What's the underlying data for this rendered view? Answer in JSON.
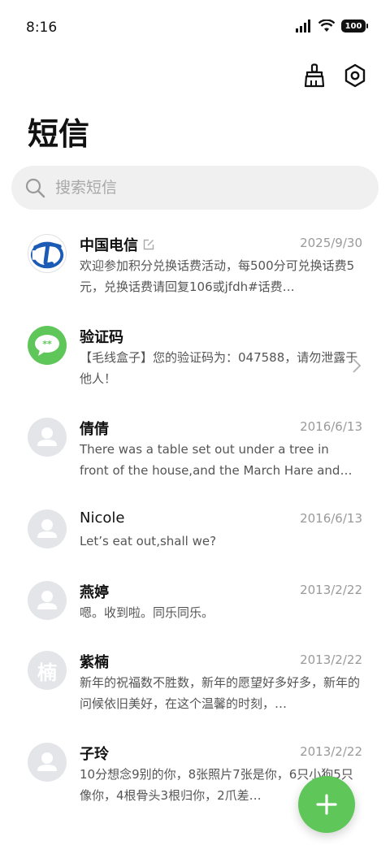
{
  "status": {
    "time": "8:16",
    "battery": "100"
  },
  "header": {
    "title": "短信"
  },
  "search": {
    "placeholder": "搜索短信"
  },
  "colors": {
    "accent": "#5fc659",
    "avatar_gray": "#e4e5e8",
    "carrier_blue": "#1c5bb5"
  },
  "messages": [
    {
      "name": "中国电信",
      "date": "2025/9/30",
      "preview": "欢迎参加积分兑换话费活动，每500分可兑换话费5元，兑换话费请回复106或jfdh#话费…",
      "avatar": "china-telecom-logo"
    },
    {
      "name": "验证码",
      "date": "",
      "preview": "【毛线盒子】您的验证码为：047588，请勿泄露于他人！",
      "avatar": "message-bubble-icon"
    },
    {
      "name": "倩倩",
      "date": "2016/6/13",
      "preview": "There was a table set out under a tree in front of the house,and the March Hare and…",
      "avatar": "person-icon"
    },
    {
      "name": "Nicole",
      "date": "2016/6/13",
      "preview": "Let’s eat out,shall we?",
      "avatar": "person-icon"
    },
    {
      "name": "燕婷",
      "date": "2013/2/22",
      "preview": "嗯。收到啦。同乐同乐。",
      "avatar": "person-icon"
    },
    {
      "name": "紫楠",
      "date": "2013/2/22",
      "preview": "新年的祝福数不胜数，新年的愿望好多好多，新年的问候依旧美好，在这个温馨的时刻，…",
      "avatar_text": "楠"
    },
    {
      "name": "子玲",
      "date": "2013/2/22",
      "preview": "10分想念9别的你，8张照片7张是你，6只小狗5只像你，4根骨头3根归你，2爪差…",
      "avatar": "person-icon"
    }
  ]
}
